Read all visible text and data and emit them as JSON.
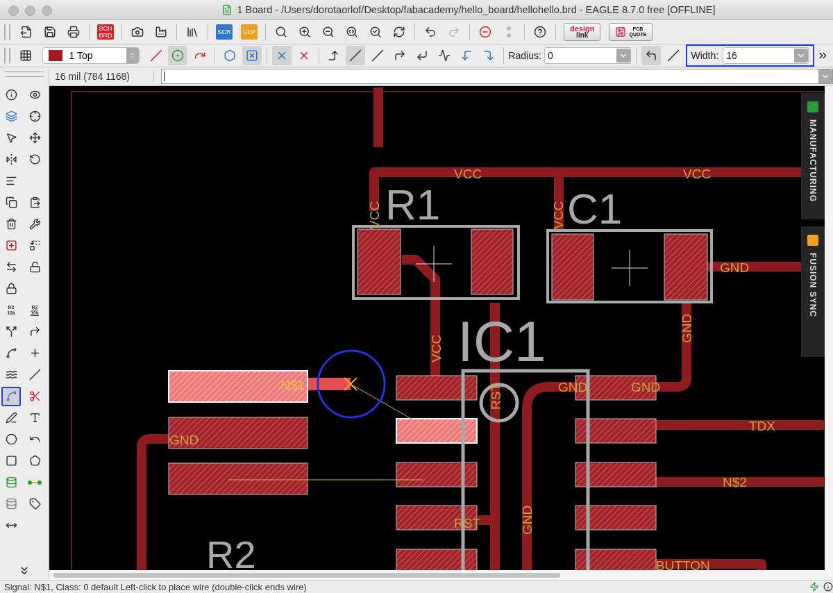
{
  "window": {
    "title": "1 Board - /Users/dorotaorlof/Desktop/fabacademy/hello_board/hellohello.brd - EAGLE 8.7.0 free [OFFLINE]"
  },
  "main_toolbar": [
    {
      "kind": "export",
      "disabled": false
    },
    {
      "kind": "save",
      "disabled": false
    },
    {
      "kind": "print",
      "disabled": false
    },
    {
      "kind": "sep"
    },
    {
      "kind": "badge",
      "lines": [
        "SCH",
        "BRD"
      ],
      "color": "#d8262c"
    },
    {
      "kind": "sep"
    },
    {
      "kind": "cam",
      "disabled": false
    },
    {
      "kind": "factory",
      "disabled": false
    },
    {
      "kind": "sep"
    },
    {
      "kind": "library",
      "disabled": false
    },
    {
      "kind": "sep"
    },
    {
      "kind": "badge",
      "lines": [
        "SCR"
      ],
      "color": "#2f78c8"
    },
    {
      "kind": "badge",
      "lines": [
        "ULP"
      ],
      "color": "#f0a020"
    },
    {
      "kind": "sep"
    },
    {
      "kind": "zoom-fit",
      "disabled": false
    },
    {
      "kind": "zoom-in",
      "disabled": false
    },
    {
      "kind": "zoom-out",
      "disabled": false
    },
    {
      "kind": "zoom-select",
      "disabled": false
    },
    {
      "kind": "zoom-last",
      "disabled": false
    },
    {
      "kind": "redraw",
      "disabled": false
    },
    {
      "kind": "sep"
    },
    {
      "kind": "undo",
      "disabled": false
    },
    {
      "kind": "redo",
      "disabled": true
    },
    {
      "kind": "sep"
    },
    {
      "kind": "stop",
      "disabled": false
    },
    {
      "kind": "go",
      "disabled": true
    },
    {
      "kind": "sep"
    },
    {
      "kind": "help",
      "disabled": false
    },
    {
      "kind": "sep"
    },
    {
      "kind": "designlink",
      "lines": [
        "design",
        "link"
      ]
    },
    {
      "kind": "pcbquote",
      "lines": [
        "PCB",
        "QUOTE"
      ]
    }
  ],
  "route_toolbar": {
    "layer": {
      "label": "1 Top",
      "color": "#9b1c1c"
    },
    "tools": [
      {
        "kind": "airwire",
        "selected": false
      },
      {
        "kind": "walkaround",
        "selected": true
      },
      {
        "kind": "push",
        "selected": false
      },
      {
        "kind": "sep"
      },
      {
        "kind": "loop",
        "selected": false
      },
      {
        "kind": "loop-remove",
        "selected": true
      },
      {
        "kind": "sep"
      },
      {
        "kind": "diff-blue",
        "selected": true
      },
      {
        "kind": "diff-red",
        "selected": false
      },
      {
        "kind": "sep"
      },
      {
        "kind": "bend-right",
        "selected": false
      },
      {
        "kind": "bend-45",
        "selected": true
      },
      {
        "kind": "bend-straight",
        "selected": false
      },
      {
        "kind": "bend-arc",
        "selected": false
      },
      {
        "kind": "bend-round",
        "selected": false
      },
      {
        "kind": "bend-s",
        "selected": false
      },
      {
        "kind": "bend-via",
        "selected": false
      },
      {
        "kind": "bend-via2",
        "selected": false
      }
    ],
    "radius": {
      "label": "Radius:",
      "value": "0"
    },
    "corners": [
      {
        "kind": "round",
        "selected": true
      },
      {
        "kind": "miter",
        "selected": false
      }
    ],
    "width": {
      "label": "Width:",
      "value": "16",
      "highlighted": true
    }
  },
  "coordinates": "16 mil (784 1168)",
  "palette": [
    [
      {
        "kind": "info",
        "selected": false
      },
      {
        "kind": "show",
        "selected": false
      }
    ],
    [
      {
        "kind": "layers",
        "selected": false
      },
      {
        "kind": "mark",
        "selected": false
      }
    ],
    [
      {
        "kind": "group",
        "selected": false
      },
      {
        "kind": "move",
        "selected": false
      }
    ],
    [
      {
        "kind": "mirror",
        "selected": false
      },
      {
        "kind": "rotate",
        "selected": false
      }
    ],
    [
      {
        "kind": "align",
        "selected": false
      }
    ],
    [
      {
        "kind": "copy",
        "selected": false
      },
      {
        "kind": "paste",
        "selected": false
      }
    ],
    [
      {
        "kind": "delete",
        "selected": false
      },
      {
        "kind": "change",
        "selected": false
      }
    ],
    [
      {
        "kind": "add",
        "selected": false
      },
      {
        "kind": "replace",
        "selected": false
      }
    ],
    [
      {
        "kind": "swap",
        "selected": false
      },
      {
        "kind": "smash",
        "selected": false
      }
    ],
    [
      {
        "kind": "lock",
        "selected": false
      }
    ],
    [
      {
        "kind": "name",
        "lines": [
          "R2",
          "10k"
        ],
        "selected": false
      },
      {
        "kind": "value",
        "lines": [
          "R2",
          "10k"
        ],
        "selected": false
      }
    ],
    [
      {
        "kind": "split",
        "selected": false
      },
      {
        "kind": "miter",
        "selected": false
      }
    ],
    [
      {
        "kind": "optimize",
        "selected": false
      },
      {
        "kind": "meander-point",
        "selected": false
      }
    ],
    [
      {
        "kind": "meander",
        "selected": false
      },
      {
        "kind": "slice",
        "selected": false
      }
    ],
    [
      {
        "kind": "route",
        "selected": true
      },
      {
        "kind": "ripup",
        "selected": false
      }
    ],
    [
      {
        "kind": "line",
        "selected": false
      },
      {
        "kind": "text",
        "selected": false
      }
    ],
    [
      {
        "kind": "circle",
        "selected": false
      },
      {
        "kind": "arc",
        "selected": false
      }
    ],
    [
      {
        "kind": "rect",
        "selected": false
      },
      {
        "kind": "polygon",
        "selected": false
      }
    ],
    [
      {
        "kind": "via",
        "selected": false
      },
      {
        "kind": "signal",
        "selected": false
      }
    ],
    [
      {
        "kind": "hole",
        "selected": false
      },
      {
        "kind": "attribute",
        "selected": false
      }
    ],
    [
      {
        "kind": "dimension",
        "selected": false
      }
    ]
  ],
  "side_panels": [
    {
      "label": "MANUFACTURING",
      "color": "#2a9a3a"
    },
    {
      "label": "FUSION SYNC",
      "color": "#f0a020"
    }
  ],
  "board": {
    "component_names": [
      "R1",
      "C1",
      "IC1",
      "R2"
    ],
    "net_labels": [
      "VCC",
      "VCC",
      "VCC",
      "VCC",
      "GND",
      "GND",
      "VCC",
      "N$1",
      "GND",
      "GND",
      "RST",
      "TDX",
      "GND",
      "N$2",
      "RST",
      "GND",
      "BUTTON"
    ]
  },
  "status_bar": "Signal: N$1, Class: 0 default Left-click to place wire (double-click ends wire)"
}
